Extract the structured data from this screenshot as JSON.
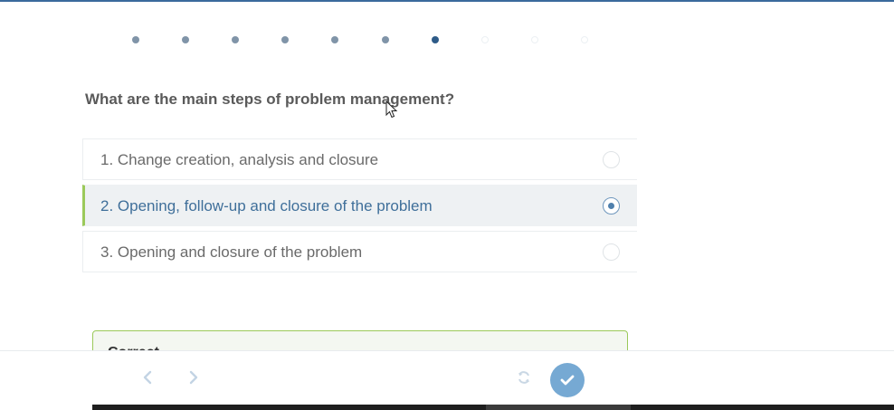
{
  "progress": {
    "total_steps": 10,
    "current_step": 7
  },
  "question": {
    "text": "What are the main steps of problem management?"
  },
  "answers": [
    {
      "label": "1. Change creation, analysis and closure",
      "selected": false
    },
    {
      "label": "2. Opening, follow-up and closure of the problem",
      "selected": true
    },
    {
      "label": "3. Opening and closure of the problem",
      "selected": false
    }
  ],
  "feedback": {
    "title": "Correct"
  },
  "toolbar": {
    "prev_icon": "chevron-left-icon",
    "next_icon": "chevron-right-icon",
    "refresh_icon": "refresh-icon",
    "submit_icon": "check-icon"
  },
  "colors": {
    "accent": "#2e5b88",
    "selected_bar": "#9bc95a",
    "submit_button": "#76a9d3"
  }
}
